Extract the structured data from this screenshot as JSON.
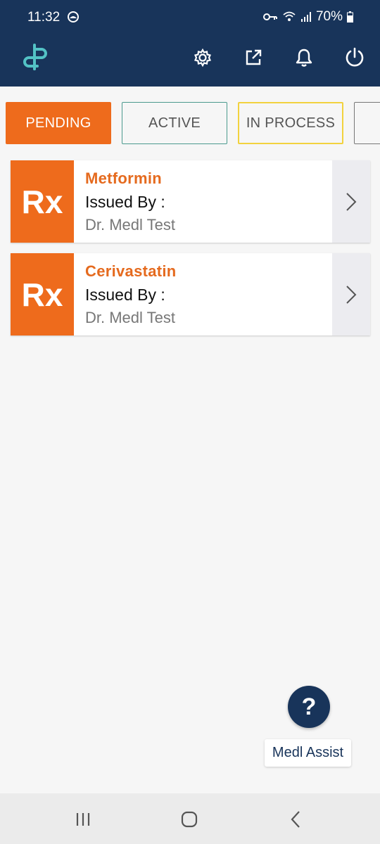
{
  "status_bar": {
    "time": "11:32",
    "battery": "70%",
    "icons": [
      "cloud-sync-icon",
      "vpn-key-icon",
      "wifi-icon",
      "signal-icon",
      "battery-icon"
    ]
  },
  "app_bar": {
    "logo_icon": "medl-logo-icon",
    "actions": [
      "settings-icon",
      "share-icon",
      "notifications-bell-icon",
      "power-icon"
    ],
    "colors": {
      "header_bg": "#18345a",
      "accent": "#ee6b1c"
    }
  },
  "tabs": [
    {
      "label": "PENDING",
      "selected": true
    },
    {
      "label": "ACTIVE"
    },
    {
      "label": "IN PROCESS"
    },
    {
      "label": ""
    }
  ],
  "prescriptions": [
    {
      "badge": "Rx",
      "name": "Metformin",
      "issued_label": "Issued By :",
      "doctor": "Dr. Medl Test"
    },
    {
      "badge": "Rx",
      "name": "Cerivastatin",
      "issued_label": "Issued By :",
      "doctor": "Dr. Medl Test"
    }
  ],
  "assist": {
    "fab_label": "?",
    "label": "Medl Assist"
  },
  "nav_bar": {
    "buttons": [
      "recent-apps-icon",
      "home-icon",
      "back-icon"
    ]
  }
}
